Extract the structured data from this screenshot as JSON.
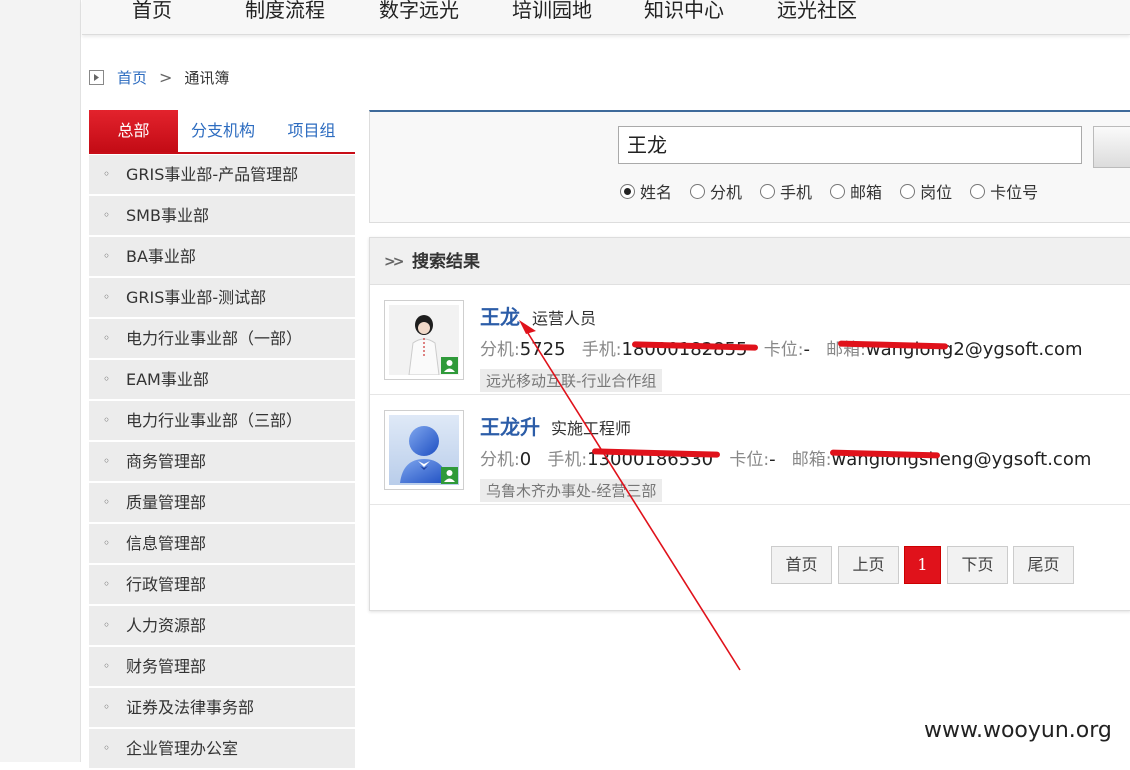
{
  "nav": {
    "items": [
      "首页",
      "制度流程",
      "数字远光",
      "培训园地",
      "知识中心",
      "远光社区"
    ]
  },
  "breadcrumb": {
    "home": "首页",
    "separator": ">",
    "current": "通讯簿"
  },
  "sidebar": {
    "tabs": [
      {
        "label": "总部",
        "active": true
      },
      {
        "label": "分支机构",
        "active": false
      },
      {
        "label": "项目组",
        "active": false
      }
    ],
    "departments": [
      "GRIS事业部-产品管理部",
      "SMB事业部",
      "BA事业部",
      "GRIS事业部-测试部",
      "电力行业事业部（一部）",
      "EAM事业部",
      "电力行业事业部（三部）",
      "商务管理部",
      "质量管理部",
      "信息管理部",
      "行政管理部",
      "人力资源部",
      "财务管理部",
      "证券及法律事务部",
      "企业管理办公室"
    ]
  },
  "search": {
    "value": "王龙",
    "options": [
      {
        "label": "姓名",
        "checked": true
      },
      {
        "label": "分机",
        "checked": false
      },
      {
        "label": "手机",
        "checked": false
      },
      {
        "label": "邮箱",
        "checked": false
      },
      {
        "label": "岗位",
        "checked": false
      },
      {
        "label": "卡位号",
        "checked": false
      }
    ]
  },
  "results": {
    "header": "搜索结果",
    "people": [
      {
        "name": "王龙",
        "role": "运营人员",
        "ext_label": "分机:",
        "ext": "5725",
        "mobile_label": "手机:",
        "mobile": "18000182855",
        "seat_label": "卡位:",
        "seat": "-",
        "email_label": "邮箱:",
        "email": "wanglong2@ygsoft.com",
        "org": "远光移动互联-行业合作组",
        "avatar": "female-photo-icon"
      },
      {
        "name": "王龙升",
        "role": "实施工程师",
        "ext_label": "分机:",
        "ext": "0",
        "mobile_label": "手机:",
        "mobile": "13000186530",
        "seat_label": "卡位:",
        "seat": "-",
        "email_label": "邮箱:",
        "email": "wanglongsheng@ygsoft.com",
        "org": "乌鲁木齐办事处-经营三部",
        "avatar": "default-user-icon"
      }
    ]
  },
  "pagination": {
    "first": "首页",
    "prev": "上页",
    "current": "1",
    "next": "下页",
    "last": "尾页"
  },
  "annotation_color": "#e0121b",
  "accent_color": "#d4101c",
  "link_color": "#2c5da8",
  "watermark": "www.wooyun.org"
}
